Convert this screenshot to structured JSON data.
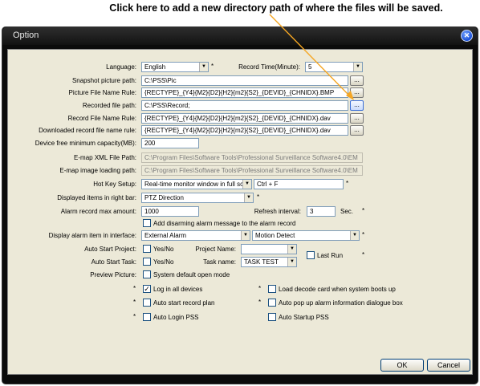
{
  "callout": "Click here to add a new directory path of where the files will be saved.",
  "window": {
    "title": "Option",
    "close_icon": "close-icon"
  },
  "labels": {
    "language": "Language:",
    "record_time": "Record Time(Minute):",
    "snapshot_path": "Snapshot picture path:",
    "picture_rule": "Picture File Name Rule:",
    "recorded_path": "Recorded file  path:",
    "record_rule": "Record File Name Rule:",
    "downloaded_rule": "Downloaded record file name rule:",
    "device_free": "Device free minimum capacity(MB):",
    "emap_xml": "E-map XML File Path:",
    "emap_image": "E-map image loading path:",
    "hotkey": "Hot Key Setup:",
    "displayed_items": "Displayed items in right bar:",
    "alarm_max": "Alarm record max amount:",
    "refresh_interval": "Refresh interval:",
    "sec": "Sec.",
    "display_alarm": "Display alarm item in interface:",
    "auto_start_project": "Auto Start Project:",
    "project_name": "Project Name:",
    "auto_start_task": "Auto Start Task:",
    "task_name": "Task name:",
    "preview_picture": "Preview Picture:"
  },
  "values": {
    "language": "English",
    "record_time": "5",
    "snapshot_path": "C:\\PSS\\Pic",
    "picture_rule": "{RECTYPE}_{Y4}{M2}{D2}{H2}{m2}{S2}_{DEVID}_{CHNIDX}.BMP",
    "recorded_path": "C:\\PSS\\Record;",
    "record_rule": "{RECTYPE}_{Y4}{M2}{D2}{H2}{m2}{S2}_{DEVID}_{CHNIDX}.dav",
    "downloaded_rule": "{RECTYPE}_{Y4}{M2}{D2}{H2}{m2}{S2}_{DEVID}_{CHNIDX}.dav",
    "device_free": "200",
    "emap_xml": "C:\\Program Files\\Software Tools\\Professional Surveillance Software4.0\\EM",
    "emap_image": "C:\\Program Files\\Software Tools\\Professional Surveillance Software4.0\\EM",
    "hotkey_action": "Real-time monitor window in full sc",
    "hotkey_keys": "Ctrl + F",
    "displayed_items": "PTZ Direction",
    "alarm_max": "1000",
    "refresh_interval": "3",
    "display_alarm_1": "External Alarm",
    "display_alarm_2": "Motion Detect",
    "task_name": "TASK TEST",
    "project_name": ""
  },
  "checkboxes": {
    "add_disarming": "Add disarming alarm message to the alarm record",
    "yes_no_project": "Yes/No",
    "yes_no_task": "Yes/No",
    "last_run": "Last Run",
    "preview_default": "System default open mode",
    "log_in_all": "Log in all devices",
    "load_decode": "Load decode card when system boots up",
    "auto_start_record": "Auto start record plan",
    "auto_popup": "Auto pop up alarm information dialogue box",
    "auto_login": "Auto Login PSS",
    "auto_startup": "Auto Startup PSS"
  },
  "checked": {
    "log_in_all": "✓"
  },
  "browse_label": "...",
  "star": "*",
  "buttons": {
    "ok": "OK",
    "cancel": "Cancel"
  },
  "colors": {
    "accent": "#3a6fd8",
    "arrow": "#f5a623",
    "panel": "#ece9d8"
  }
}
